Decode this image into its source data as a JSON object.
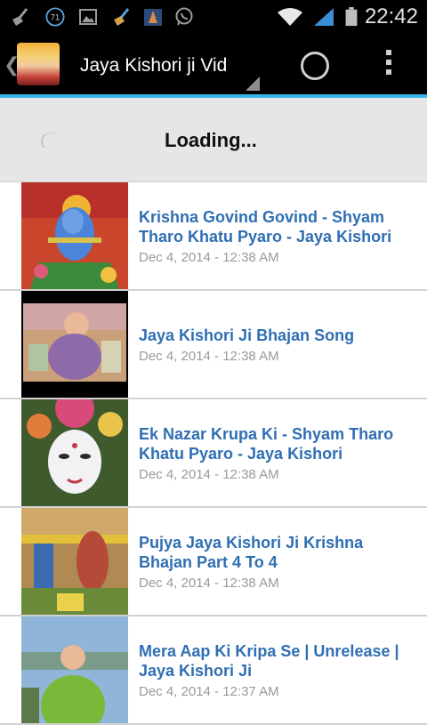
{
  "status_bar": {
    "time": "22:42",
    "notification_count": "71",
    "icons": [
      "broom-icon",
      "count-badge-icon",
      "image-icon",
      "broom-icon",
      "temple-icon",
      "whatsapp-icon",
      "wifi-icon",
      "signal-icon",
      "battery-icon"
    ]
  },
  "action_bar": {
    "title": "Jaya Kishori ji Vid",
    "icons": [
      "back-chevron-icon",
      "app-avatar-icon",
      "dropdown-triangle-icon",
      "loading-spinner-icon",
      "overflow-menu-icon"
    ]
  },
  "loading": {
    "text": "Loading..."
  },
  "videos": [
    {
      "title": "Krishna Govind Govind - Shyam Tharo Khatu Pyaro - Jaya Kishori",
      "date": "Dec 4, 2014 - 12:38 AM"
    },
    {
      "title": "Jaya Kishori Ji Bhajan Song",
      "date": "Dec 4, 2014 - 12:38 AM"
    },
    {
      "title": "Ek Nazar Krupa Ki - Shyam Tharo Khatu Pyaro - Jaya Kishori",
      "date": "Dec 4, 2014 - 12:38 AM"
    },
    {
      "title": "Pujya Jaya Kishori Ji Krishna Bhajan Part 4 To 4",
      "date": "Dec 4, 2014 - 12:38 AM"
    },
    {
      "title": "Mera Aap Ki Kripa Se | Unrelease | Jaya Kishori Ji",
      "date": "Dec 4, 2014 - 12:37 AM"
    }
  ],
  "colors": {
    "accent": "#33b5e5",
    "link_title": "#2f6fb3",
    "date_text": "#9a9a9a"
  }
}
